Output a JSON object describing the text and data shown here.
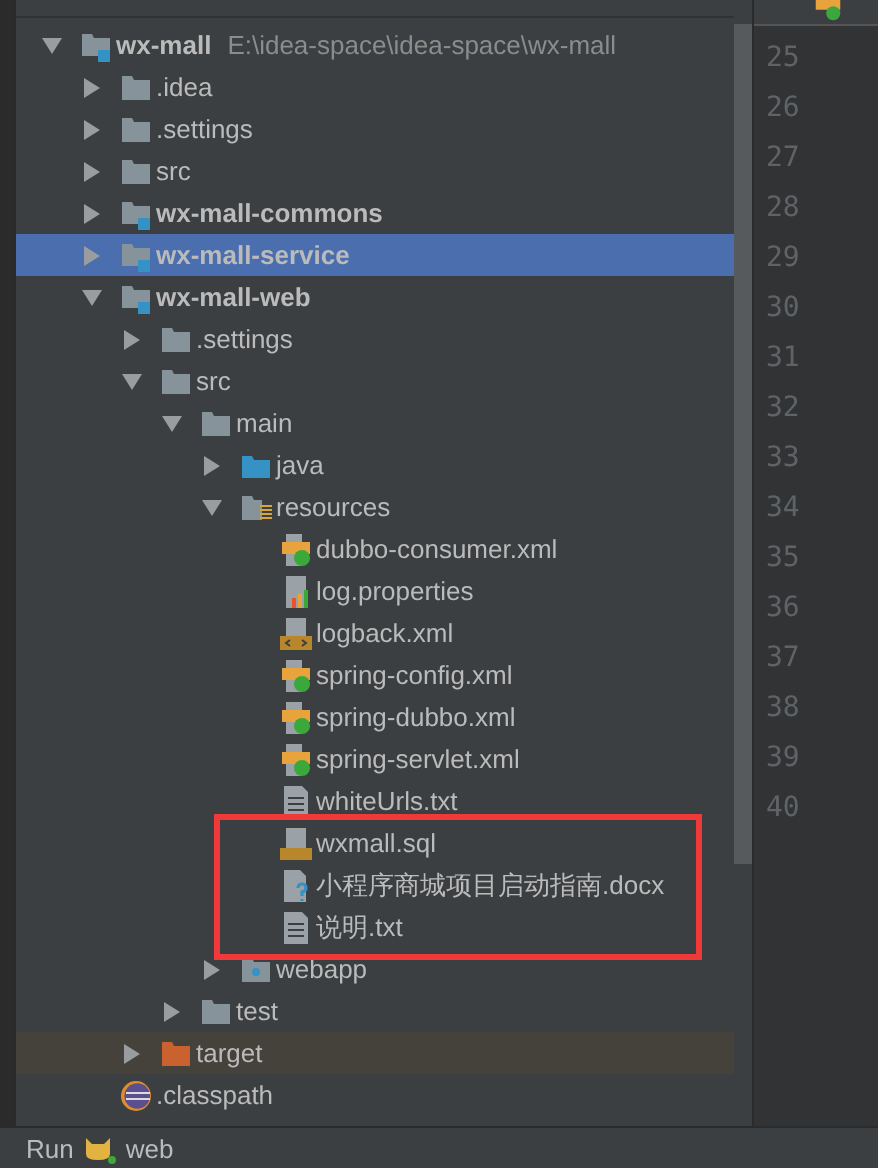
{
  "project_tree": [
    {
      "label": "wx-mall",
      "path": "E:\\idea-space\\idea-space\\wx-mall",
      "kind": "module",
      "expanded": true,
      "selected": false,
      "children": [
        {
          "label": ".idea",
          "kind": "folder",
          "expanded": false,
          "selected": false
        },
        {
          "label": ".settings",
          "kind": "folder",
          "expanded": false,
          "selected": false
        },
        {
          "label": "src",
          "kind": "folder",
          "expanded": false,
          "selected": false
        },
        {
          "label": "wx-mall-commons",
          "kind": "module",
          "expanded": false,
          "selected": false
        },
        {
          "label": "wx-mall-service",
          "kind": "module",
          "expanded": false,
          "selected": true
        },
        {
          "label": "wx-mall-web",
          "kind": "module",
          "expanded": true,
          "selected": false,
          "children": [
            {
              "label": ".settings",
              "kind": "folder",
              "expanded": false,
              "selected": false
            },
            {
              "label": "src",
              "kind": "folder",
              "expanded": true,
              "selected": false,
              "children": [
                {
                  "label": "main",
                  "kind": "folder",
                  "expanded": true,
                  "selected": false,
                  "children": [
                    {
                      "label": "java",
                      "kind": "source-folder",
                      "expanded": false,
                      "selected": false
                    },
                    {
                      "label": "resources",
                      "kind": "resources-folder",
                      "expanded": true,
                      "selected": false,
                      "children": [
                        {
                          "label": "dubbo-consumer.xml",
                          "kind": "spring-xml",
                          "selected": false
                        },
                        {
                          "label": "log.properties",
                          "kind": "properties",
                          "selected": false
                        },
                        {
                          "label": "logback.xml",
                          "kind": "xml",
                          "selected": false
                        },
                        {
                          "label": "spring-config.xml",
                          "kind": "spring-xml",
                          "selected": false
                        },
                        {
                          "label": "spring-dubbo.xml",
                          "kind": "spring-xml",
                          "selected": false
                        },
                        {
                          "label": "spring-servlet.xml",
                          "kind": "spring-xml",
                          "selected": false
                        },
                        {
                          "label": "whiteUrls.txt",
                          "kind": "text",
                          "selected": false
                        },
                        {
                          "label": "wxmall.sql",
                          "kind": "sql",
                          "selected": false,
                          "boxed": true
                        },
                        {
                          "label": "小程序商城项目启动指南.docx",
                          "kind": "unknown",
                          "selected": false,
                          "boxed": true
                        },
                        {
                          "label": "说明.txt",
                          "kind": "text",
                          "selected": false,
                          "boxed": true
                        }
                      ]
                    },
                    {
                      "label": "webapp",
                      "kind": "web-folder",
                      "expanded": false,
                      "selected": false
                    }
                  ]
                },
                {
                  "label": "test",
                  "kind": "folder",
                  "expanded": false,
                  "selected": false
                }
              ]
            },
            {
              "label": "target",
              "kind": "excluded-folder",
              "expanded": false,
              "selected": false
            }
          ]
        },
        {
          "label": ".classpath",
          "kind": "classpath",
          "selected": false
        }
      ]
    }
  ],
  "gutter": {
    "line_numbers": [
      "25",
      "26",
      "27",
      "28",
      "29",
      "30",
      "31",
      "32",
      "33",
      "34",
      "35",
      "36",
      "37",
      "38",
      "39",
      "40"
    ]
  },
  "status_bar": {
    "label": "Run",
    "config": "web"
  }
}
